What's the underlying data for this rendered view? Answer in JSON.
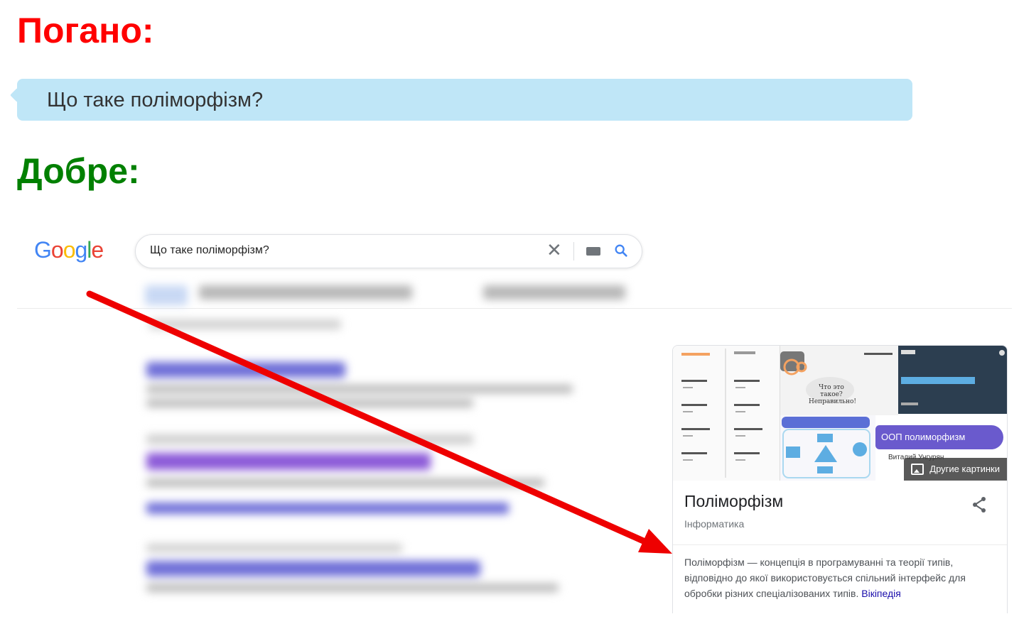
{
  "headings": {
    "bad": "Погано:",
    "good": "Добре:"
  },
  "bad_example": {
    "query": "Що таке поліморфізм?"
  },
  "google": {
    "logo": "Google",
    "search_value": "Що таке поліморфізм?",
    "knowledge_panel": {
      "title": "Поліморфізм",
      "subtitle": "Інформатика",
      "description": "Поліморфізм — концепція в програмуванні та теорії типів, відповідно до якої використовується спільний інтерфейс для обробки різних спеціалізованих типів.",
      "source_link": "Вікіпедія",
      "more_images_label": "Другие картинки",
      "image_captions": {
        "question": "Что это такое? Неправильно!",
        "oop": "ООП полиморфизм",
        "author": "Виталий Унгурян"
      }
    }
  },
  "colors": {
    "bad": "#ff0000",
    "good": "#008000",
    "bubble": "#bfe6f7",
    "arrow": "#ee0000"
  }
}
